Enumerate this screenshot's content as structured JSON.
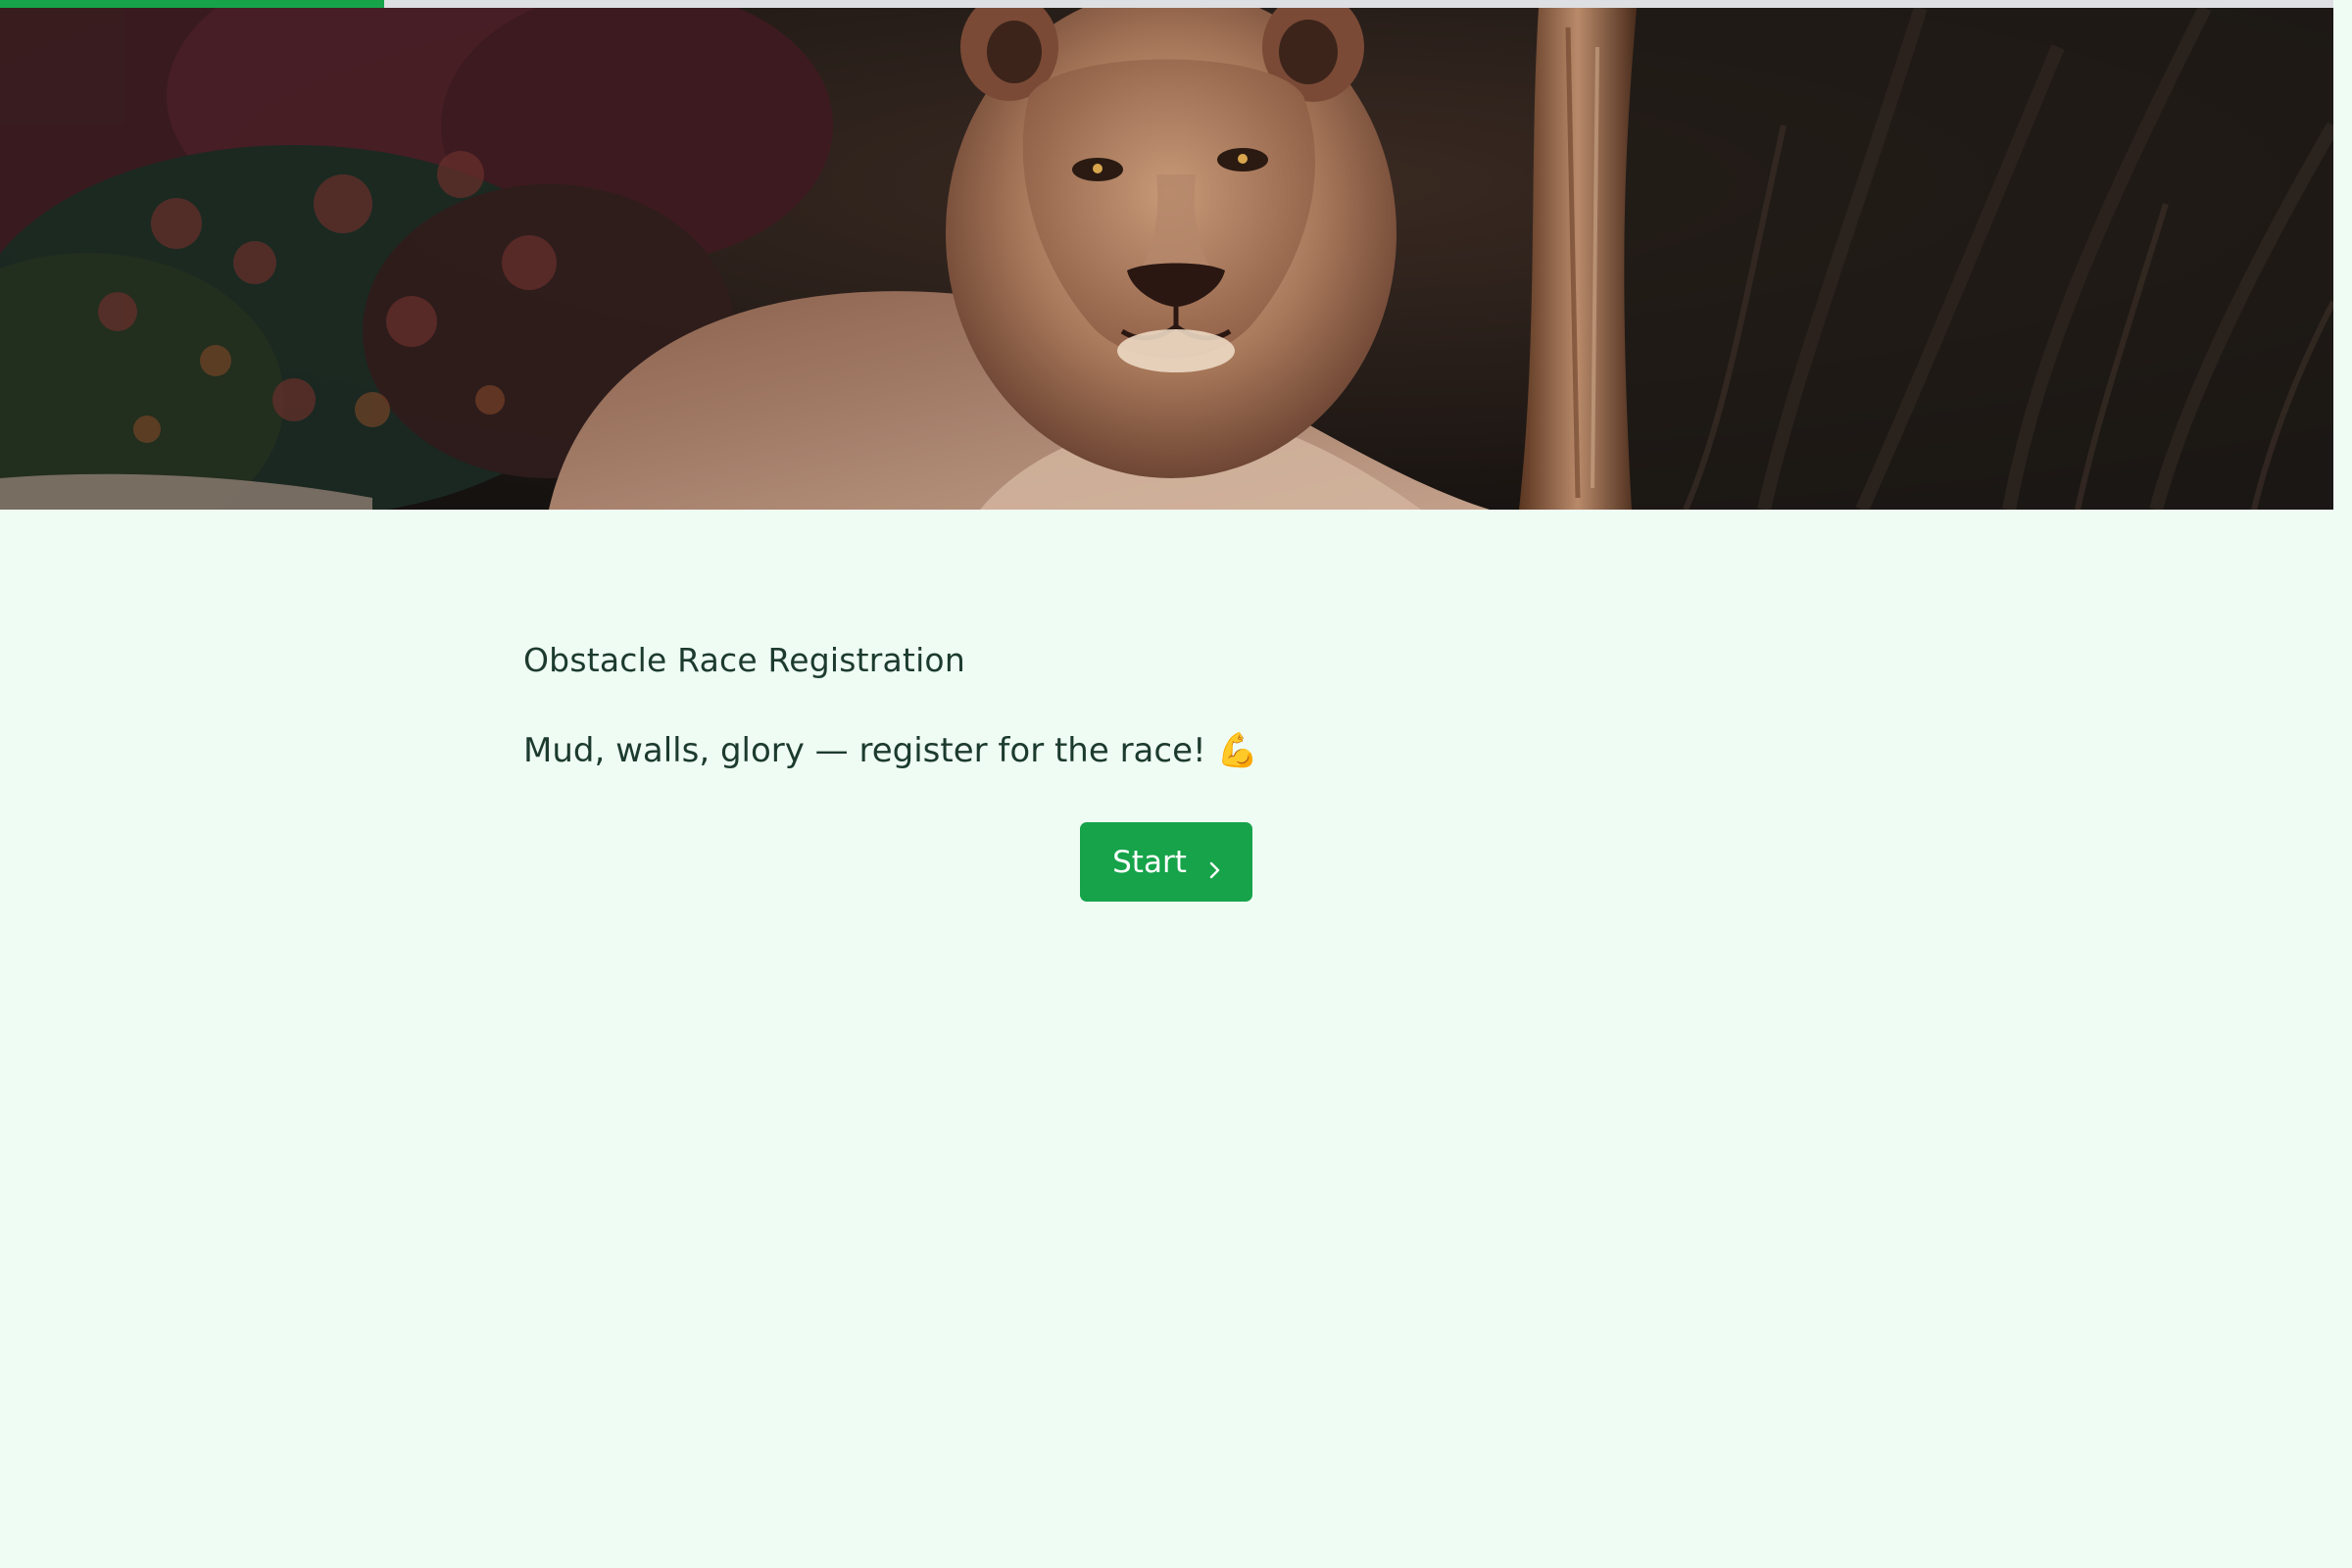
{
  "progress": {
    "fraction": 0.1647,
    "fill_color": "#16a34a",
    "track_color": "#dedfe2"
  },
  "hero": {
    "image_subject": "lion",
    "icon": "hero-image"
  },
  "form": {
    "title": "Obstacle Race Registration",
    "subtitle": "Mud, walls, glory — register for the race! 💪",
    "start_label": "Start",
    "start_icon": "chevron-right-icon",
    "accent_color": "#16a34a",
    "background_color": "#effcf3"
  }
}
